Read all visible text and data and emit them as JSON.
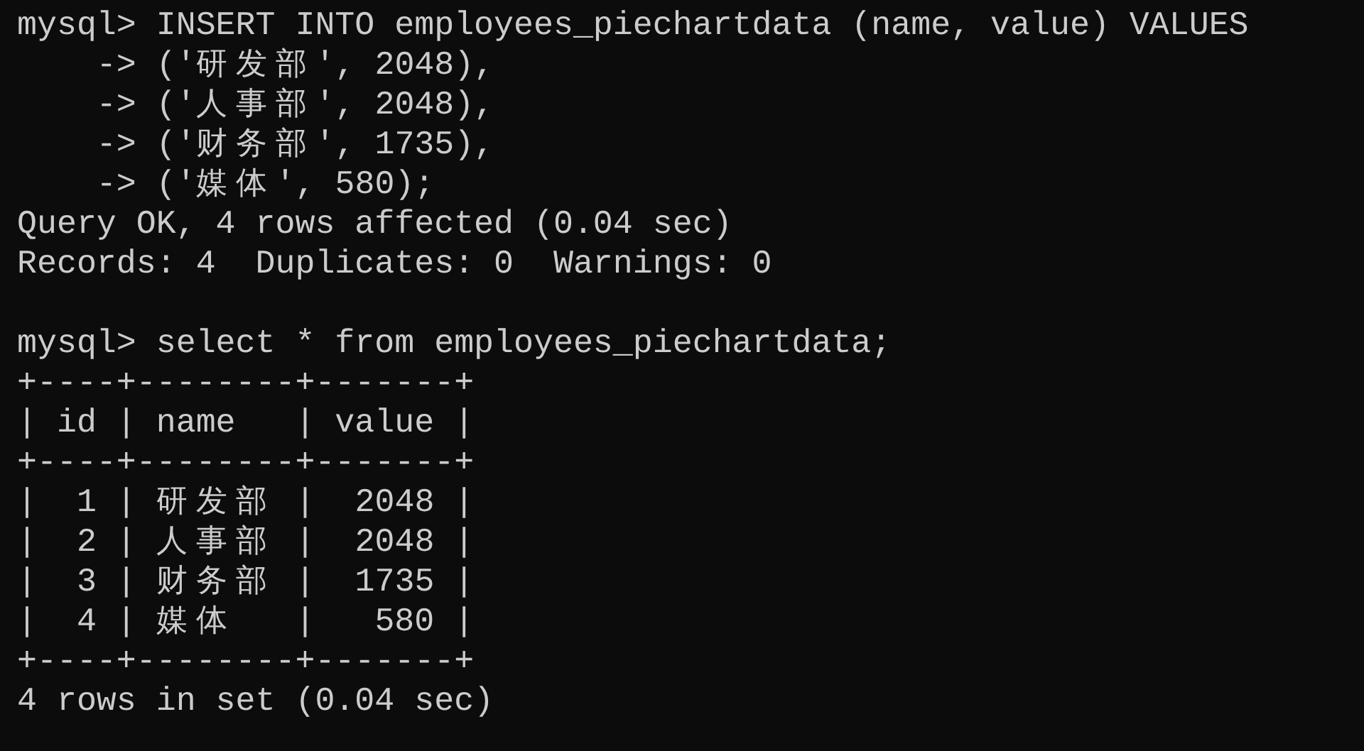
{
  "terminal": {
    "lines": [
      {
        "kind": "command",
        "text": "mysql> INSERT INTO employees_piechartdata (name, value) VALUES"
      },
      {
        "kind": "command",
        "text": "    -> ('研发部', 2048),"
      },
      {
        "kind": "command",
        "text": "    -> ('人事部', 2048),"
      },
      {
        "kind": "command",
        "text": "    -> ('财务部', 1735),"
      },
      {
        "kind": "command",
        "text": "    -> ('媒体', 580);"
      },
      {
        "kind": "output",
        "text": "Query OK, 4 rows affected (0.04 sec)"
      },
      {
        "kind": "output",
        "text": "Records: 4  Duplicates: 0  Warnings: 0"
      },
      {
        "kind": "blank"
      },
      {
        "kind": "command",
        "text": "mysql> select * from employees_piechartdata;"
      },
      {
        "kind": "table",
        "text": "+----+--------+-------+"
      },
      {
        "kind": "table",
        "text": "| id | name   | value |"
      },
      {
        "kind": "table",
        "text": "+----+--------+-------+"
      },
      {
        "kind": "table",
        "text": "|  1 | 研发部 |  2048 |"
      },
      {
        "kind": "table",
        "text": "|  2 | 人事部 |  2048 |"
      },
      {
        "kind": "table",
        "text": "|  3 | 财务部 |  1735 |"
      },
      {
        "kind": "table",
        "text": "|  4 | 媒体   |   580 |"
      },
      {
        "kind": "table",
        "text": "+----+--------+-------+"
      },
      {
        "kind": "output",
        "text": "4 rows in set (0.04 sec)"
      }
    ]
  }
}
